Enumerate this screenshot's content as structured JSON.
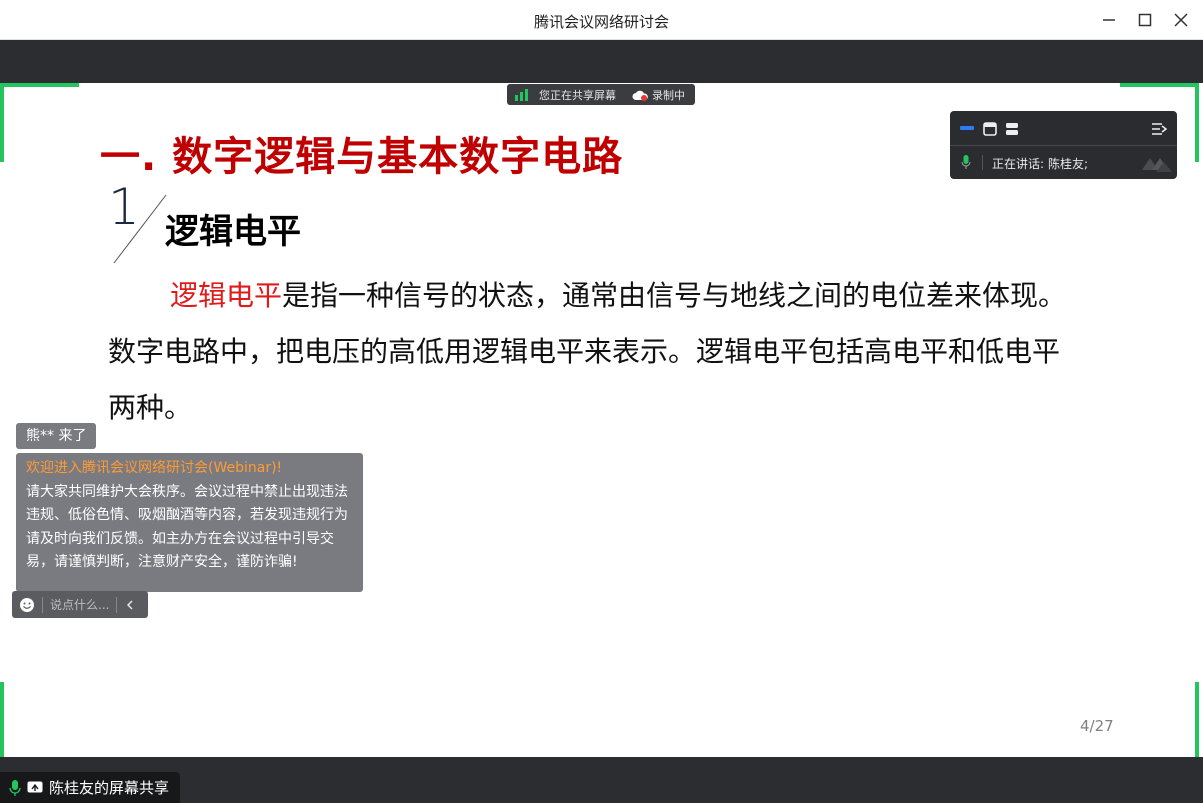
{
  "window": {
    "title": "腾讯会议网络研讨会"
  },
  "share_banner": {
    "sharing_text": "您正在共享屏幕",
    "recording_text": "录制中"
  },
  "slide": {
    "title": "一. 数字逻辑与基本数字电路",
    "section_number": "1",
    "subtitle": "逻辑电平",
    "paragraph_highlight": "逻辑电平",
    "paragraph_rest": "是指一种信号的状态，通常由信号与地线之间的电位差来体现。数字电路中，把电压的高低用逻辑电平来表示。逻辑电平包括高电平和低电平两种。",
    "page_number": "4/27"
  },
  "speaker_panel": {
    "speaking_label": "正在讲话:",
    "speaker_name": "陈桂友;"
  },
  "chat": {
    "join_toast": "熊** 来了",
    "welcome": "欢迎进入腾讯会议网络研讨会(Webinar)!",
    "notice": "请大家共同维护大会秩序。会议过程中禁止出现违法违规、低俗色情、吸烟酗酒等内容，若发现违规行为请及时向我们反馈。如主办方在会议过程中引导交易，请谨慎判断，注意财产安全，谨防诈骗!",
    "input_placeholder": "说点什么..."
  },
  "bottom_bar": {
    "share_label": "陈桂友的屏幕共享"
  },
  "colors": {
    "accent_green": "#22c55e",
    "title_red": "#c00000",
    "highlight_red": "#e01b1b",
    "welcome_orange": "#ff9a33"
  }
}
